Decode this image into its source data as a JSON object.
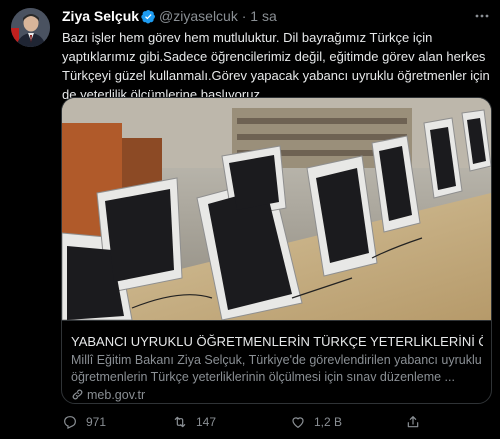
{
  "tweet": {
    "author_name": "Ziya Selçuk",
    "handle": "@ziyaselcuk",
    "separator": "·",
    "time": "1 sa",
    "more_icon": "more-dots-icon",
    "text": "Bazı işler hem görev hem mutluluktur. Dil bayrağımız Türkçe için yaptıklarımız gibi.Sadece öğrencilerimiz değil, eğitimde görev alan herkes Türkçeyi güzel kullanmalı.Görev yapacak yabancı uyruklu öğretmenler için de yeterlilik ölçümlerine başlıyoruz."
  },
  "card": {
    "image_alt": "computer-lab-monitors",
    "title": "YABANCI UYRUKLU ÖĞRETMENLERİN TÜRKÇE YETERLİKLERİNİ ÖLÇMEK ...",
    "description": "Millî Eğitim Bakanı Ziya Selçuk, Türkiye'de görevlendirilen yabancı uyruklu öğretmenlerin Türkçe yeterliklerinin ölçülmesi için sınav düzenleme ...",
    "domain": "meb.gov.tr"
  },
  "actions": {
    "reply_count": "971",
    "retweet_count": "147",
    "like_count": "1,2 B"
  },
  "colors": {
    "background": "#000000",
    "text": "#e7e9ea",
    "secondary": "#8a8f94",
    "verified": "#1d9bf0",
    "border": "#2f3336"
  }
}
